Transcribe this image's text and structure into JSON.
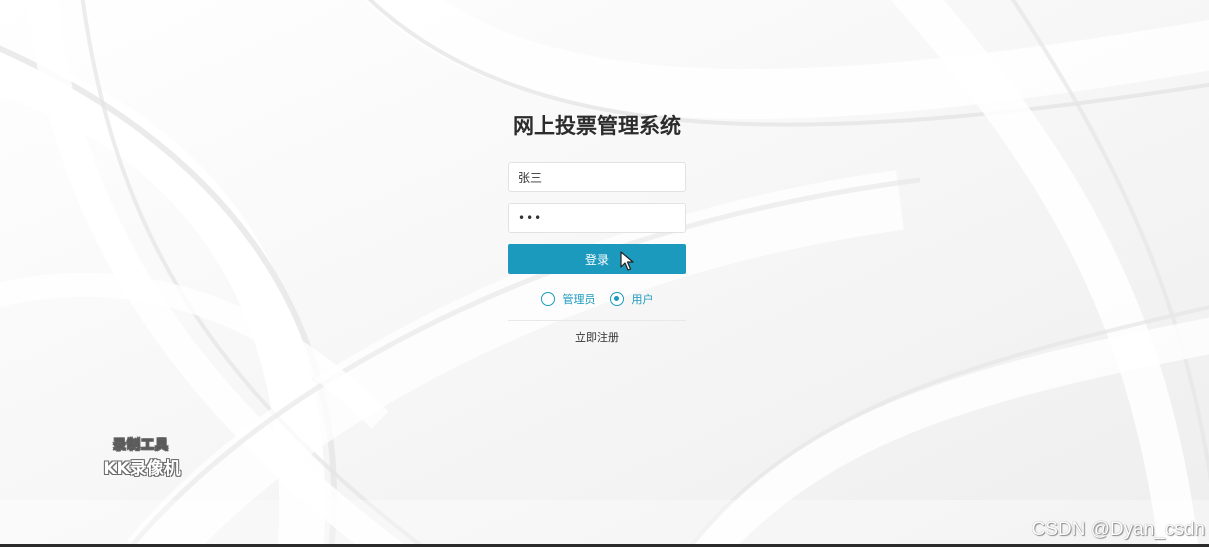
{
  "app": {
    "title": "网上投票管理系统"
  },
  "login_form": {
    "username_value": "张三",
    "password_value": "•••",
    "login_label": "登录",
    "roles": [
      {
        "label": "管理员",
        "checked": false
      },
      {
        "label": "用户",
        "checked": true
      }
    ],
    "register_label": "立即注册"
  },
  "overlays": {
    "recorder_line1": "录制工具",
    "recorder_line2": "KK录像机",
    "watermark": "CSDN @Dyan_csdn"
  },
  "colors": {
    "accent": "#1b9abe",
    "background": "#f6f6f6"
  },
  "icons": {
    "cursor": "mouse-pointer-icon",
    "radio_unchecked": "radio-unchecked-icon",
    "radio_checked": "radio-checked-icon"
  }
}
